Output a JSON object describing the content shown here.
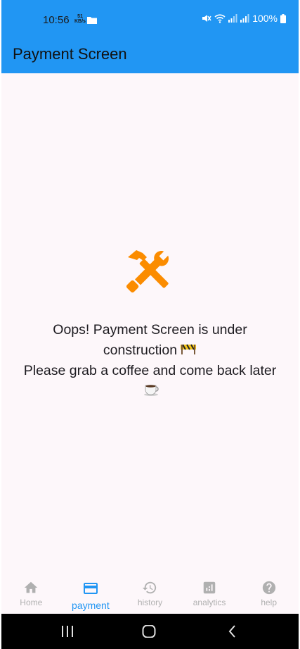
{
  "status_bar": {
    "time": "10:56",
    "net_speed": "51",
    "net_unit": "KB/s",
    "battery": "100%"
  },
  "app_bar": {
    "title": "Payment Screen"
  },
  "main": {
    "line1": "Oops! Payment Screen is under construction",
    "line2": "Please grab a coffee and come back later",
    "tools_icon": "hammer-wrench-icon",
    "construction_emoji": "construction-barrier-icon",
    "coffee_emoji": "coffee-cup-icon"
  },
  "bottom_nav": {
    "active_index": 1,
    "items": [
      {
        "label": "Home",
        "icon": "home-icon"
      },
      {
        "label": "payment",
        "icon": "credit-card-icon"
      },
      {
        "label": "history",
        "icon": "history-icon"
      },
      {
        "label": "analytics",
        "icon": "analytics-icon"
      },
      {
        "label": "help",
        "icon": "help-icon"
      }
    ]
  },
  "colors": {
    "primary": "#2196f3",
    "background": "#fdf7fa",
    "tools_orange": "#fb8c00",
    "inactive_nav": "#b0b0b0"
  }
}
